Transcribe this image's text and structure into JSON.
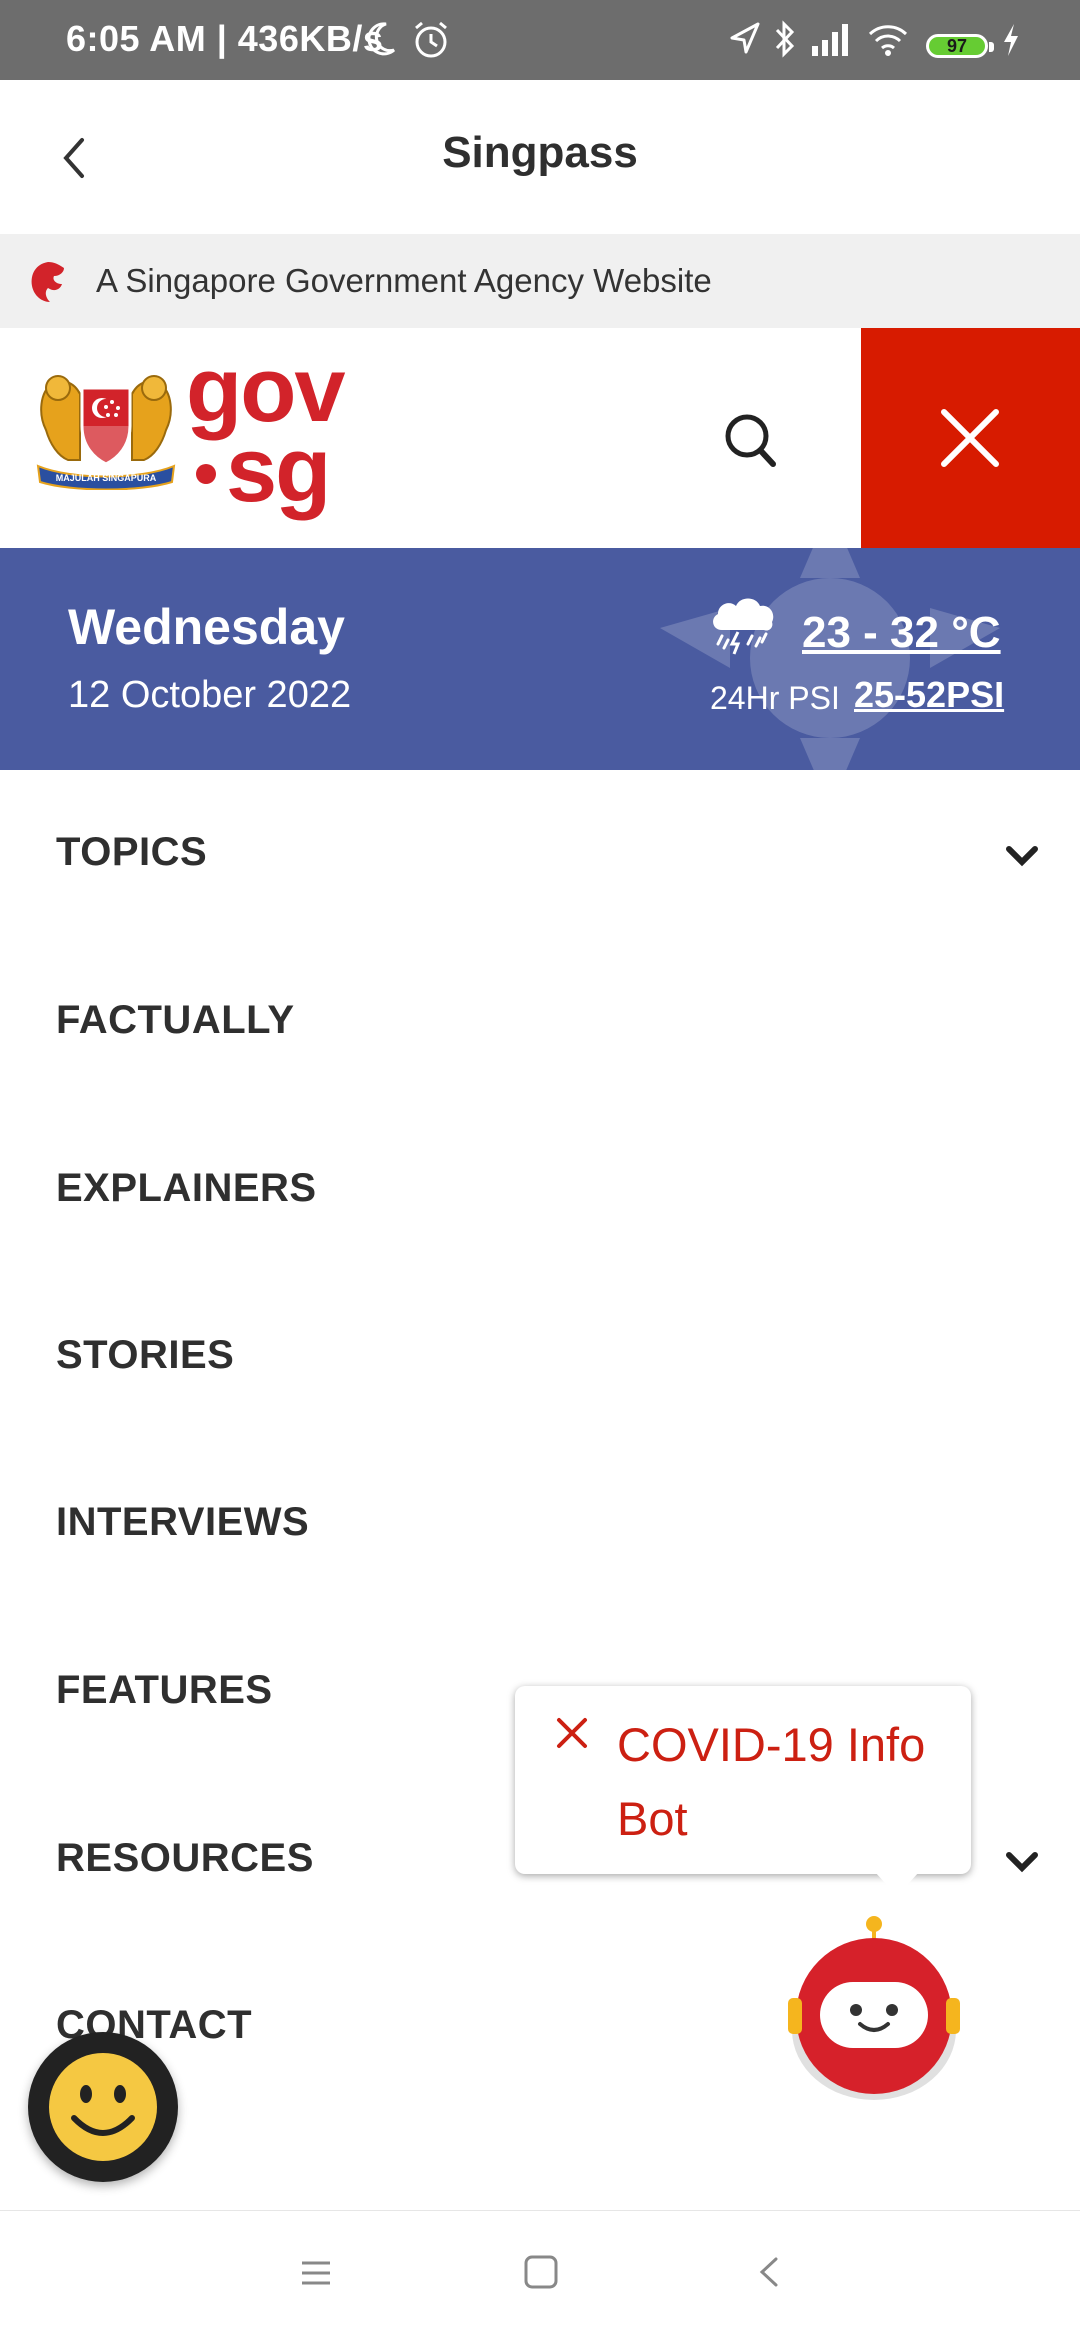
{
  "status_bar": {
    "time_speed": "6:05 AM | 436KB/s",
    "battery": "97"
  },
  "app_bar": {
    "title": "Singpass"
  },
  "gov_banner": {
    "text": "A Singapore Government Agency Website"
  },
  "header": {
    "logo_gov": "gov",
    "logo_sg": "sg",
    "crest_motto": "MAJULAH SINGAPURA"
  },
  "weather": {
    "day": "Wednesday",
    "date": "12 October 2022",
    "temperature": "23 - 32 °C",
    "psi_label": "24Hr PSI",
    "psi_value": "25-52PSI",
    "icon": "thunderstorm-icon"
  },
  "menu": {
    "items": [
      {
        "label": "TOPICS",
        "expandable": true
      },
      {
        "label": "FACTUALLY",
        "expandable": false
      },
      {
        "label": "EXPLAINERS",
        "expandable": false
      },
      {
        "label": "STORIES",
        "expandable": false
      },
      {
        "label": "INTERVIEWS",
        "expandable": false
      },
      {
        "label": "FEATURES",
        "expandable": false
      },
      {
        "label": "RESOURCES",
        "expandable": true
      },
      {
        "label": "CONTACT",
        "expandable": false
      }
    ]
  },
  "chatbot": {
    "label": "COVID-19 Info Bot"
  },
  "colors": {
    "brand_red": "#d2232a",
    "close_red": "#d71b00",
    "weather_blue": "#4a5ba0",
    "status_gray": "#6d6d6d"
  }
}
